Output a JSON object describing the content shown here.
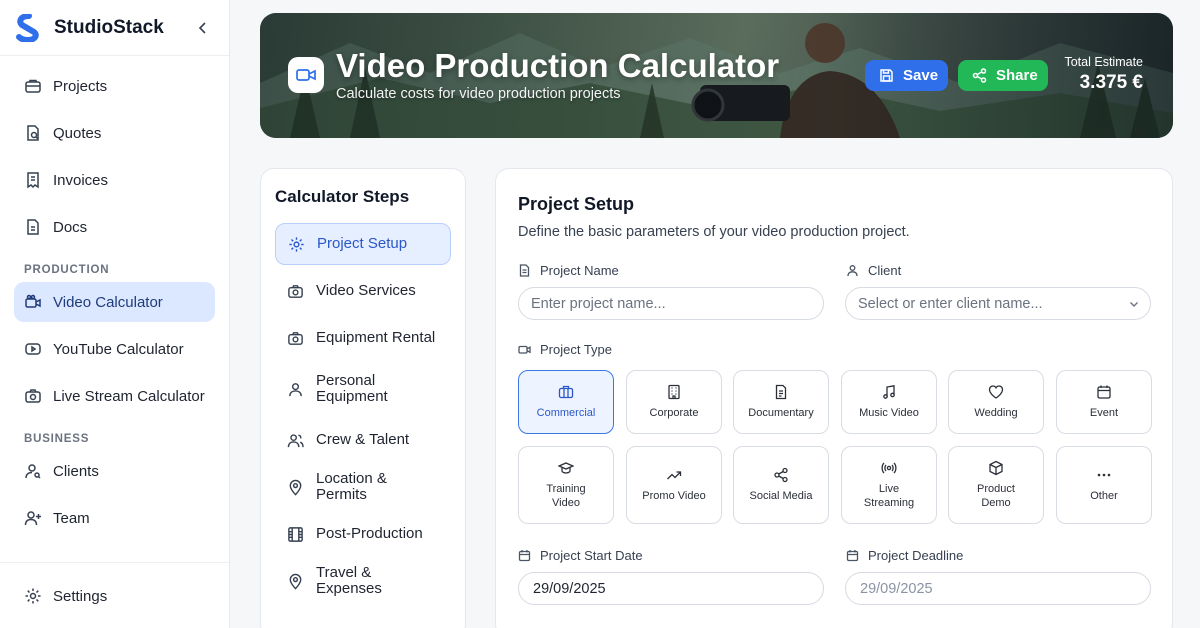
{
  "brand": {
    "name": "StudioStack"
  },
  "sidebar": {
    "items": [
      {
        "label": "Projects",
        "icon": "briefcase-icon"
      },
      {
        "label": "Quotes",
        "icon": "document-search-icon"
      },
      {
        "label": "Invoices",
        "icon": "receipt-icon"
      },
      {
        "label": "Docs",
        "icon": "file-icon"
      }
    ],
    "sections": [
      {
        "title": "PRODUCTION",
        "items": [
          {
            "label": "Video Calculator",
            "icon": "video-camera-icon",
            "active": true
          },
          {
            "label": "YouTube Calculator",
            "icon": "youtube-icon"
          },
          {
            "label": "Live Stream Calculator",
            "icon": "live-camera-icon"
          }
        ]
      },
      {
        "title": "BUSINESS",
        "items": [
          {
            "label": "Clients",
            "icon": "user-search-icon"
          },
          {
            "label": "Team",
            "icon": "user-plus-icon"
          }
        ]
      }
    ],
    "footer": {
      "label": "Settings",
      "icon": "gear-icon"
    }
  },
  "hero": {
    "title": "Video Production Calculator",
    "subtitle": "Calculate costs for video production projects",
    "save_label": "Save",
    "share_label": "Share",
    "estimate_label": "Total Estimate",
    "estimate_value": "3.375 €"
  },
  "steps": {
    "title": "Calculator Steps",
    "items": [
      {
        "label": "Project Setup",
        "icon": "gear-icon",
        "active": true
      },
      {
        "label": "Video Services",
        "icon": "camera-icon"
      },
      {
        "label": "Equipment Rental",
        "icon": "camera-icon"
      },
      {
        "label": "Personal Equipment",
        "icon": "user-icon"
      },
      {
        "label": "Crew & Talent",
        "icon": "users-icon"
      },
      {
        "label": "Location & Permits",
        "icon": "map-pin-icon"
      },
      {
        "label": "Post-Production",
        "icon": "film-icon"
      },
      {
        "label": "Travel & Expenses",
        "icon": "map-pin-icon"
      }
    ]
  },
  "setup": {
    "title": "Project Setup",
    "description": "Define the basic parameters of your video production project.",
    "project_name_label": "Project Name",
    "project_name_placeholder": "Enter project name...",
    "client_label": "Client",
    "client_placeholder": "Select or enter client name...",
    "project_type_label": "Project Type",
    "project_types": [
      {
        "label": "Commercial",
        "icon": "briefcase-icon",
        "selected": true
      },
      {
        "label": "Corporate",
        "icon": "building-icon"
      },
      {
        "label": "Documentary",
        "icon": "document-icon"
      },
      {
        "label": "Music Video",
        "icon": "music-note-icon"
      },
      {
        "label": "Wedding",
        "icon": "heart-icon"
      },
      {
        "label": "Event",
        "icon": "calendar-icon"
      },
      {
        "label": "Training Video",
        "icon": "graduation-cap-icon"
      },
      {
        "label": "Promo Video",
        "icon": "trending-up-icon"
      },
      {
        "label": "Social Media",
        "icon": "share-icon"
      },
      {
        "label": "Live Streaming",
        "icon": "broadcast-icon"
      },
      {
        "label": "Product Demo",
        "icon": "box-icon"
      },
      {
        "label": "Other",
        "icon": "more-icon"
      }
    ],
    "start_date_label": "Project Start Date",
    "start_date_value": "29/09/2025",
    "deadline_label": "Project Deadline",
    "deadline_value": "29/09/2025"
  },
  "colors": {
    "accent": "#2f6fea",
    "share": "#22b857",
    "active_nav_bg": "#dbe8ff"
  }
}
